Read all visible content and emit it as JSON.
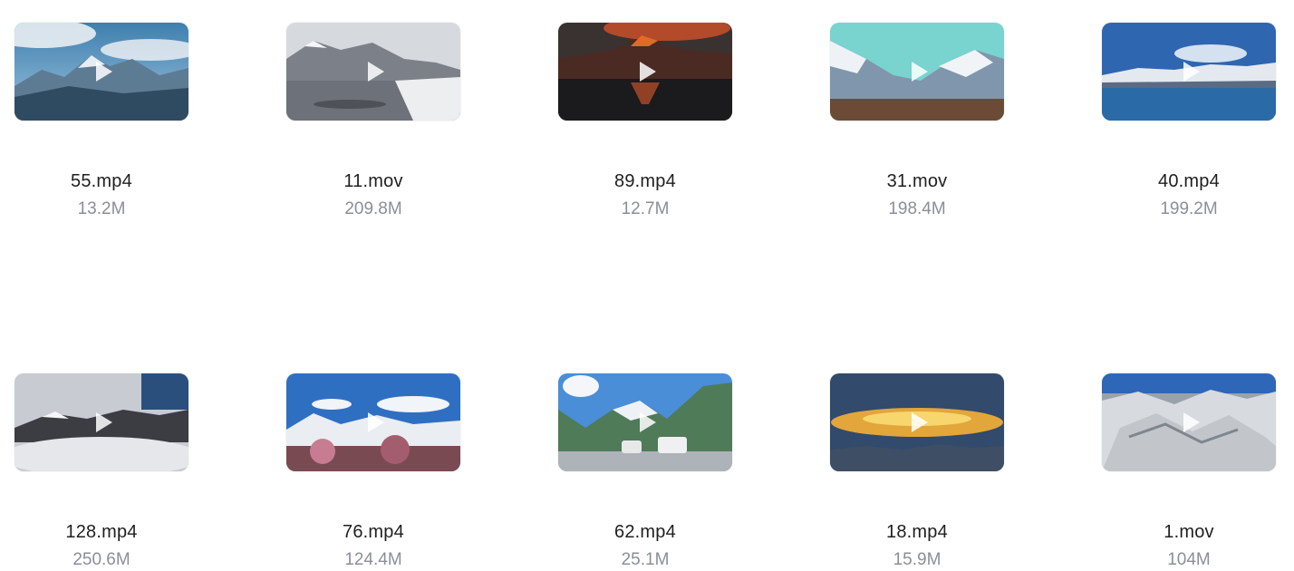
{
  "files": [
    {
      "name": "55.mp4",
      "size": "13.2M",
      "thumb": "thumb-1"
    },
    {
      "name": "11.mov",
      "size": "209.8M",
      "thumb": "thumb-2"
    },
    {
      "name": "89.mp4",
      "size": "12.7M",
      "thumb": "thumb-3"
    },
    {
      "name": "31.mov",
      "size": "198.4M",
      "thumb": "thumb-4"
    },
    {
      "name": "40.mp4",
      "size": "199.2M",
      "thumb": "thumb-5"
    },
    {
      "name": "128.mp4",
      "size": "250.6M",
      "thumb": "thumb-6"
    },
    {
      "name": "76.mp4",
      "size": "124.4M",
      "thumb": "thumb-7"
    },
    {
      "name": "62.mp4",
      "size": "25.1M",
      "thumb": "thumb-8"
    },
    {
      "name": "18.mp4",
      "size": "15.9M",
      "thumb": "thumb-9"
    },
    {
      "name": "1.mov",
      "size": "104M",
      "thumb": "thumb-10"
    }
  ],
  "icons": {
    "play": "play-icon"
  }
}
